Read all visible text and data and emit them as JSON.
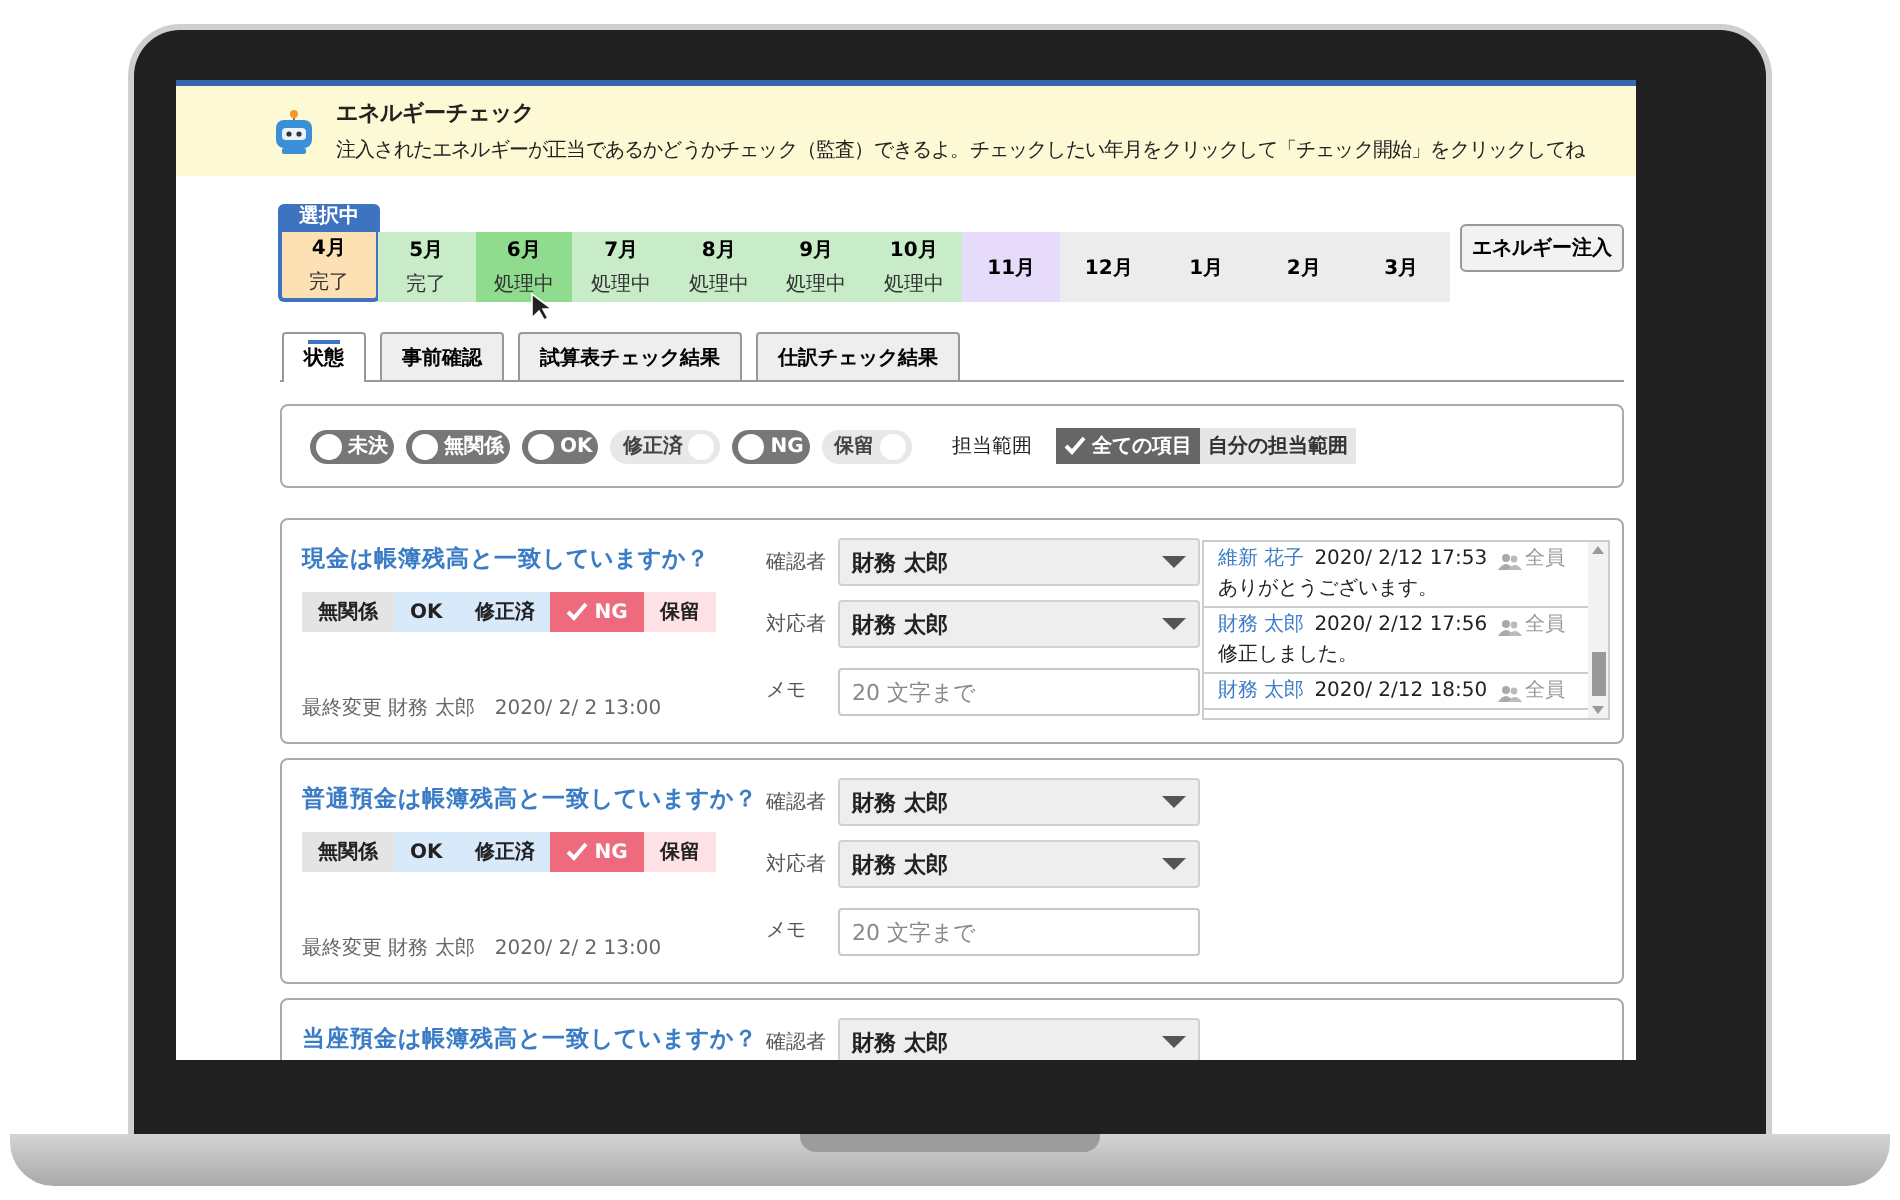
{
  "app": {
    "title": "エネルギーチェック",
    "description": "注入されたエネルギーが正当であるかどうかチェック（監査）できるよ。チェックしたい年月をクリックして「チェック開始」をクリックしてね"
  },
  "months": {
    "selected_badge": "選択中",
    "items": [
      {
        "label": "4月",
        "status": "完了",
        "kind": "done",
        "selected": true,
        "hovered": false
      },
      {
        "label": "5月",
        "status": "完了",
        "kind": "done",
        "selected": false,
        "hovered": false
      },
      {
        "label": "6月",
        "status": "処理中",
        "kind": "processing",
        "selected": false,
        "hovered": true
      },
      {
        "label": "7月",
        "status": "処理中",
        "kind": "processing",
        "selected": false,
        "hovered": false
      },
      {
        "label": "8月",
        "status": "処理中",
        "kind": "processing",
        "selected": false,
        "hovered": false
      },
      {
        "label": "9月",
        "status": "処理中",
        "kind": "processing",
        "selected": false,
        "hovered": false
      },
      {
        "label": "10月",
        "status": "処理中",
        "kind": "processing",
        "selected": false,
        "hovered": false
      },
      {
        "label": "11月",
        "kind": "pending",
        "selected": false,
        "hovered": false
      },
      {
        "label": "12月",
        "kind": "none",
        "selected": false,
        "hovered": false
      },
      {
        "label": "1月",
        "kind": "none",
        "selected": false,
        "hovered": false
      },
      {
        "label": "2月",
        "kind": "none",
        "selected": false,
        "hovered": false
      },
      {
        "label": "3月",
        "kind": "none",
        "selected": false,
        "hovered": false
      }
    ]
  },
  "inject_button": "エネルギー注入",
  "tabs": [
    {
      "label": "状態",
      "selected": true
    },
    {
      "label": "事前確認",
      "selected": false
    },
    {
      "label": "試算表チェック結果",
      "selected": false
    },
    {
      "label": "仕訳チェック結果",
      "selected": false
    }
  ],
  "filters": {
    "toggles": [
      {
        "label": "未決",
        "on": false
      },
      {
        "label": "無関係",
        "on": false
      },
      {
        "label": "OK",
        "on": false
      },
      {
        "label": "修正済",
        "on": true
      },
      {
        "label": "NG",
        "on": false
      },
      {
        "label": "保留",
        "on": true
      }
    ],
    "scope_label": "担当範囲",
    "scope": [
      {
        "label": "全ての項目",
        "selected": true
      },
      {
        "label": "自分の担当範囲",
        "selected": false
      }
    ]
  },
  "cards": [
    {
      "question": "現金は帳簿残高と一致していますか？",
      "options": [
        {
          "label": "無関係",
          "kind": "neutral",
          "selected": false
        },
        {
          "label": "OK",
          "kind": "positive",
          "selected": false
        },
        {
          "label": "修正済",
          "kind": "positive",
          "selected": false
        },
        {
          "label": "NG",
          "kind": "negative",
          "selected": true
        },
        {
          "label": "保留",
          "kind": "negative",
          "selected": false
        }
      ],
      "last_modified": "最終変更 財務 太郎　2020/ 2/ 2 13:00",
      "fields": [
        {
          "label": "確認者",
          "kind": "select",
          "value": "財務 太郎"
        },
        {
          "label": "対応者",
          "kind": "select",
          "value": "財務 太郎"
        },
        {
          "label": "メモ",
          "kind": "text",
          "placeholder": "20 文字まで"
        }
      ],
      "comments": [
        {
          "author": "維新 花子",
          "time": "2020/ 2/12 17:53",
          "audience": "全員",
          "text": "ありがとうございます。"
        },
        {
          "author": "財務 太郎",
          "time": "2020/ 2/12 17:56",
          "audience": "全員",
          "text": "修正しました。"
        },
        {
          "author": "財務 太郎",
          "time": "2020/ 2/12 18:50",
          "audience": "全員"
        }
      ]
    },
    {
      "question": "普通預金は帳簿残高と一致していますか？",
      "options": [
        {
          "label": "無関係",
          "kind": "neutral",
          "selected": false
        },
        {
          "label": "OK",
          "kind": "positive",
          "selected": false
        },
        {
          "label": "修正済",
          "kind": "positive",
          "selected": false
        },
        {
          "label": "NG",
          "kind": "negative",
          "selected": true
        },
        {
          "label": "保留",
          "kind": "negative",
          "selected": false
        }
      ],
      "last_modified": "最終変更 財務 太郎　2020/ 2/ 2 13:00",
      "fields": [
        {
          "label": "確認者",
          "kind": "select",
          "value": "財務 太郎"
        },
        {
          "label": "対応者",
          "kind": "select",
          "value": "財務 太郎"
        },
        {
          "label": "メモ",
          "kind": "text",
          "placeholder": "20 文字まで"
        }
      ]
    },
    {
      "question": "当座預金は帳簿残高と一致していますか？",
      "fields": [
        {
          "label": "確認者",
          "kind": "select",
          "value": "財務 太郎"
        }
      ]
    }
  ]
}
